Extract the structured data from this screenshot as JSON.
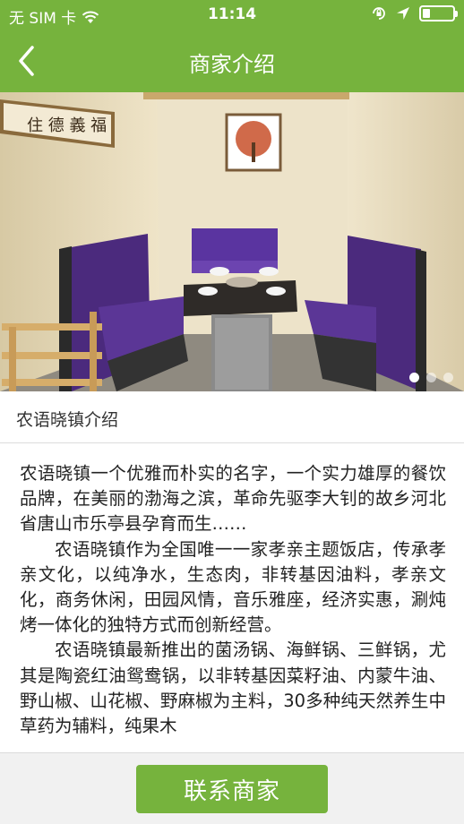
{
  "status_bar": {
    "carrier": "无 SIM 卡",
    "time": "11:14",
    "battery_level": 0.25,
    "icons": [
      "wifi-icon",
      "rotation-lock-icon",
      "location-icon",
      "battery-icon"
    ]
  },
  "nav": {
    "title": "商家介绍",
    "back_icon": "chevron-left-icon"
  },
  "banner": {
    "image": "restaurant-private-room-photo",
    "slide_count": 3,
    "active_slide": 1
  },
  "section": {
    "heading": "农语晓镇介绍"
  },
  "content": {
    "paragraphs": [
      "农语晓镇一个优雅而朴实的名字，一个实力雄厚的餐饮品牌，在美丽的渤海之滨，革命先驱李大钊的故乡河北省唐山市乐亭县孕育而生……",
      "农语晓镇作为全国唯一一家孝亲主题饭店，传承孝亲文化，以纯净水，生态肉，非转基因油料，孝亲文化，商务休闲，田园风情，音乐雅座，经济实惠，涮炖烤一体化的独特方式而创新经营。",
      "农语晓镇最新推出的菌汤锅、海鲜锅、三鲜锅，尤其是陶瓷红油鸳鸯锅，以非转基因菜籽油、内蒙牛油、野山椒、山花椒、野麻椒为主料，30多种纯天然养生中草药为辅料，纯果木"
    ]
  },
  "bottom": {
    "contact_label": "联系商家"
  },
  "colors": {
    "brand_green": "#76b33d",
    "bottom_bar_bg": "#f1f1f1",
    "text": "#222222"
  }
}
